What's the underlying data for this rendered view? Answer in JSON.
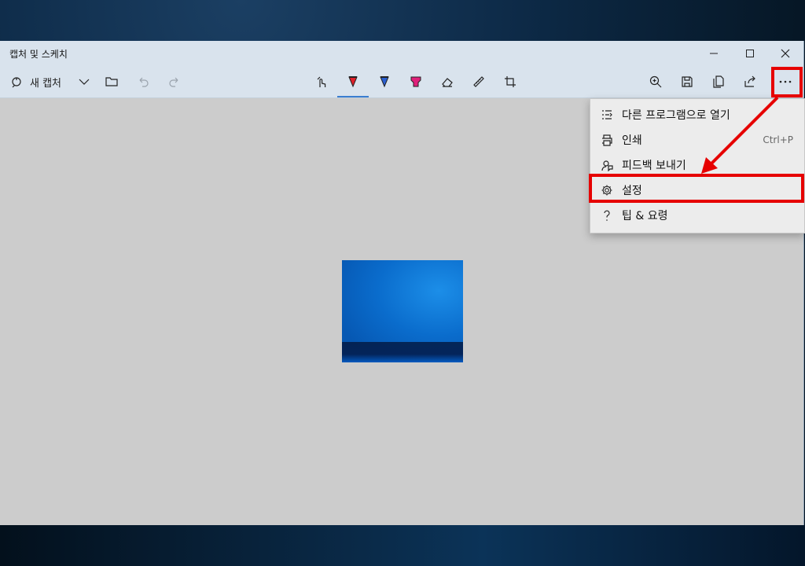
{
  "window": {
    "title": "캡처 및 스케치"
  },
  "toolbar": {
    "new_capture_label": "새 캡처",
    "icons": [
      "new-capture-icon",
      "chevron-down-icon",
      "folder-icon",
      "undo-icon",
      "redo-icon",
      "touch-writing-icon",
      "ballpoint-pen-icon",
      "pencil-icon",
      "highlighter-icon",
      "eraser-icon",
      "ruler-icon",
      "crop-icon",
      "zoom-icon",
      "save-icon",
      "copy-icon",
      "share-icon",
      "more-icon"
    ]
  },
  "menu": {
    "items": [
      {
        "label": "다른 프로그램으로 열기",
        "icon": "open-with-icon",
        "shortcut": ""
      },
      {
        "label": "인쇄",
        "icon": "print-icon",
        "shortcut": "Ctrl+P"
      },
      {
        "label": "피드백 보내기",
        "icon": "feedback-icon",
        "shortcut": ""
      },
      {
        "label": "설정",
        "icon": "settings-gear-icon",
        "shortcut": ""
      },
      {
        "label": "팁 & 요령",
        "icon": "help-question-icon",
        "shortcut": ""
      }
    ]
  },
  "colors": {
    "highlight_box": "#e60000",
    "pen_red": "#e0202a",
    "pen_blue": "#2a5fd0",
    "highlighter_pink": "#e0207a",
    "active_underline": "#3b7ed0"
  }
}
